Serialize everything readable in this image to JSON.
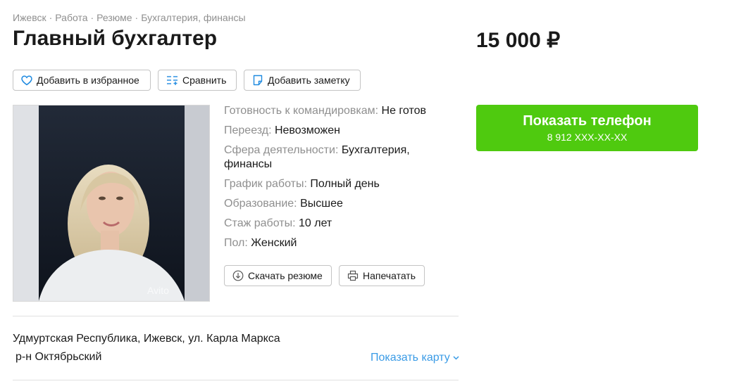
{
  "breadcrumb": {
    "items": [
      "Ижевск",
      "Работа",
      "Резюме",
      "Бухгалтерия, финансы"
    ],
    "separator": "·"
  },
  "title": "Главный бухгалтер",
  "price": "15 000 ₽",
  "actions": {
    "favorite_label": "Добавить в избранное",
    "compare_label": "Сравнить",
    "note_label": "Добавить заметку"
  },
  "photo": {
    "watermark": "Avito"
  },
  "params": [
    {
      "key": "Готовность к командировкам:",
      "value": "Не готов"
    },
    {
      "key": "Переезд:",
      "value": "Невозможен"
    },
    {
      "key": "Сфера деятельности:",
      "value": "Бухгалтерия, финансы"
    },
    {
      "key": "График работы:",
      "value": "Полный день"
    },
    {
      "key": "Образование:",
      "value": "Высшее"
    },
    {
      "key": "Стаж работы:",
      "value": "10 лет"
    },
    {
      "key": "Пол:",
      "value": "Женский"
    }
  ],
  "resume_actions": {
    "download_label": "Скачать резюме",
    "print_label": "Напечатать"
  },
  "phone": {
    "button_label": "Показать телефон",
    "masked_number": "8 912 XXX-XX-XX"
  },
  "location": {
    "address": "Удмуртская Республика, Ижевск, ул. Карла Маркса",
    "district": "р-н Октябрьский",
    "map_link": "Показать карту"
  },
  "colors": {
    "accent_green": "#4fca0f",
    "link_blue": "#3a9be6",
    "icon_blue": "#1f8ae0",
    "muted": "#8f8f8f"
  },
  "icons": {
    "favorite": "heart-icon",
    "compare": "compare-icon",
    "note": "note-icon",
    "download": "download-icon",
    "print": "print-icon",
    "map": "chevron-down-icon"
  }
}
